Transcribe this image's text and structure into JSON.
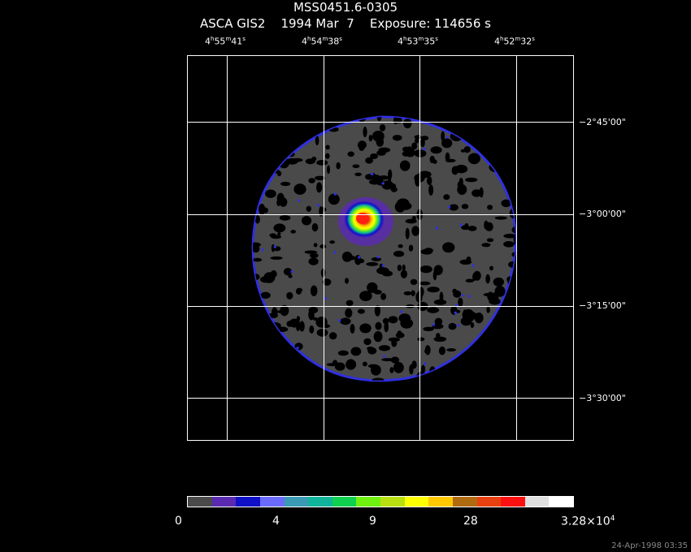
{
  "header": {
    "title": "MSS0451.6-0305",
    "subtitle": "ASCA GIS2    1994 Mar  7    Exposure: 114656 s"
  },
  "ra_labels": [
    {
      "h": "4",
      "m": "55",
      "s": "41"
    },
    {
      "h": "4",
      "m": "54",
      "s": "38"
    },
    {
      "h": "4",
      "m": "53",
      "s": "35"
    },
    {
      "h": "4",
      "m": "52",
      "s": "32"
    }
  ],
  "dec_labels": [
    "−2°45'00\"",
    "−3°00'00\"",
    "−3°15'00\"",
    "−3°30'00\""
  ],
  "colorbar": {
    "colors": [
      "#4a4a4a",
      "#5a2ab0",
      "#1010c8",
      "#6a6aff",
      "#3a9ab4",
      "#10b49a",
      "#10d050",
      "#70f010",
      "#b8e010",
      "#ffff00",
      "#ffc800",
      "#b06a10",
      "#e84010",
      "#ff1010",
      "#e0e0e0",
      "#ffffff"
    ],
    "labels": {
      "l0": "0",
      "l1": "4",
      "l2": "9",
      "l3": "28",
      "max_mantissa": "3.28×10",
      "max_exp": "4"
    }
  },
  "timestamp": "24-Apr-1998 03:35"
}
